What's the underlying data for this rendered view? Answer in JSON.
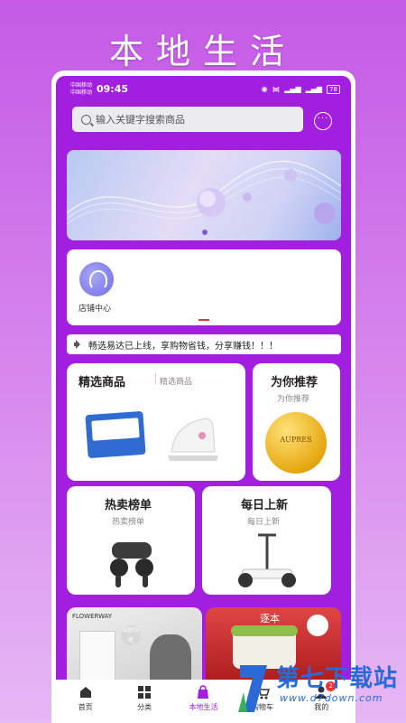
{
  "header": {
    "title": "本地生活"
  },
  "status_bar": {
    "carrier_1": "中国移动",
    "carrier_2": "中国移动",
    "time": "09:45",
    "battery": "78"
  },
  "search": {
    "placeholder": "输入关键字搜索商品"
  },
  "banner": {
    "active_dot": 1
  },
  "store": {
    "label": "店铺中心"
  },
  "notice": {
    "text": "畅选易达已上线，享购物省钱，分享赚钱！！！"
  },
  "cards": {
    "featured": {
      "title": "精选商品",
      "subtitle": "精选商品"
    },
    "recommend": {
      "title": "为你推荐",
      "subtitle": "为你推荐",
      "product_text": "AUPRES"
    },
    "hot": {
      "title": "热卖榜单",
      "subtitle": "热卖榜单"
    },
    "daily": {
      "title": "每日上新",
      "subtitle": "每日上新"
    },
    "promo_left": {
      "brand": "FLOWERWAY",
      "tag": "出龄抗老"
    },
    "promo_right": {
      "tag": "逐本"
    }
  },
  "bottom_nav": {
    "items": [
      {
        "label": "首页",
        "icon": "home-icon"
      },
      {
        "label": "分类",
        "icon": "grid-icon"
      },
      {
        "label": "本地生活",
        "icon": "bag-icon",
        "active": true
      },
      {
        "label": "购物车",
        "icon": "cart-icon"
      },
      {
        "label": "我的",
        "icon": "user-icon",
        "badge": "2"
      }
    ]
  },
  "watermark": {
    "text": "第七下载站",
    "url": "www.d7down.com"
  },
  "colors": {
    "accent": "#a21fe0",
    "background": "#c45ae6",
    "link": "#2a6ad8"
  }
}
